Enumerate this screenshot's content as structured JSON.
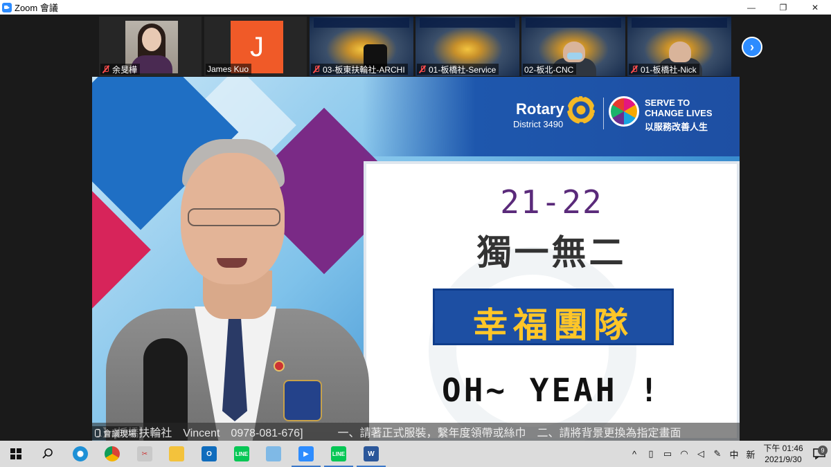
{
  "window": {
    "title": "Zoom 會議",
    "minimize": "—",
    "restore": "❐",
    "close": "✕"
  },
  "participants": [
    {
      "name": "余旻樺",
      "muted": true,
      "type": "photo"
    },
    {
      "name": "James Kuo",
      "muted": false,
      "type": "initial",
      "initial": "J"
    },
    {
      "name": "03-板東扶輪社-ARCHI",
      "muted": true,
      "type": "virtual-bg"
    },
    {
      "name": "01-板橋社-Service",
      "muted": true,
      "type": "virtual-bg"
    },
    {
      "name": "02-板北-CNC",
      "muted": false,
      "type": "virtual-bg"
    },
    {
      "name": "01-板橋社-Nick",
      "muted": true,
      "type": "virtual-bg"
    }
  ],
  "next_page_icon": "chevron-right-icon",
  "main_video": {
    "rotary": "Rotary",
    "district": "District 3490",
    "serve_line1": "SERVE TO",
    "serve_line2": "CHANGE LIVES",
    "serve_zh": "以服務改善人生",
    "line1": "21-22",
    "line2": "獨一無二",
    "line3": "幸福團隊",
    "line4": "OH~ YEAH !",
    "ticker_left": "1】[板橋扶輪社　Vincent　0978-081-676]",
    "ticker_right": "一、請著正式服裝，繫年度領帶或絲巾　二、請將背景更換為指定畫面",
    "speaker_label": "會議現場"
  },
  "taskbar": {
    "apps": [
      "start",
      "search",
      "internet-explorer",
      "chrome",
      "snipping-tool",
      "file-explorer",
      "outlook",
      "line",
      "notepad",
      "zoom",
      "line",
      "word"
    ],
    "clock_time": "下午 01:46",
    "clock_date": "2021/9/30",
    "notification_count": "9",
    "ime": "中",
    "keyboard": "新"
  },
  "colors": {
    "zoom_blue": "#2d8cff",
    "rotary_blue": "#1e4fa3",
    "gold": "#ffc628",
    "purple": "#5a2a7a"
  }
}
